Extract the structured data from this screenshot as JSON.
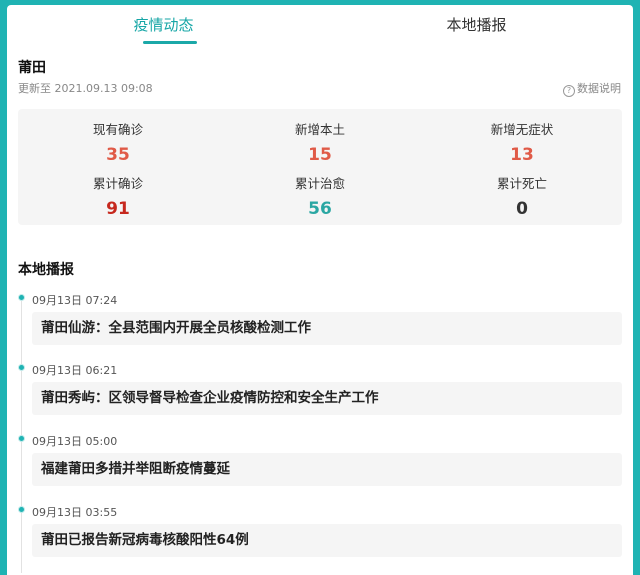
{
  "tabs": [
    {
      "label": "疫情动态",
      "active": true
    },
    {
      "label": "本地播报",
      "active": false
    }
  ],
  "location": {
    "city": "莆田",
    "updated": "更新至 2021.09.13 09:08",
    "data_note": "数据说明"
  },
  "colors": {
    "accent": "#1fb3b3",
    "confirm_red": "#e05a47",
    "cumulative_red": "#c6281e",
    "cured_teal": "#2aa7a3",
    "death_gray": "#333333"
  },
  "stats": [
    {
      "label": "现有确诊",
      "value": "35"
    },
    {
      "label": "新增本土",
      "value": "15"
    },
    {
      "label": "新增无症状",
      "value": "13"
    },
    {
      "label": "累计确诊",
      "value": "91"
    },
    {
      "label": "累计治愈",
      "value": "56"
    },
    {
      "label": "累计死亡",
      "value": "0"
    }
  ],
  "local_news": {
    "title": "本地播报",
    "items": [
      {
        "time": "09月13日  07:24",
        "text": "莆田仙游：全县范围内开展全员核酸检测工作"
      },
      {
        "time": "09月13日  06:21",
        "text": "莆田秀屿：区领导督导检查企业疫情防控和安全生产工作"
      },
      {
        "time": "09月13日  05:00",
        "text": "福建莆田多措并举阻断疫情蔓延"
      },
      {
        "time": "09月13日  03:55",
        "text": "莆田已报告新冠病毒核酸阳性64例"
      }
    ]
  }
}
